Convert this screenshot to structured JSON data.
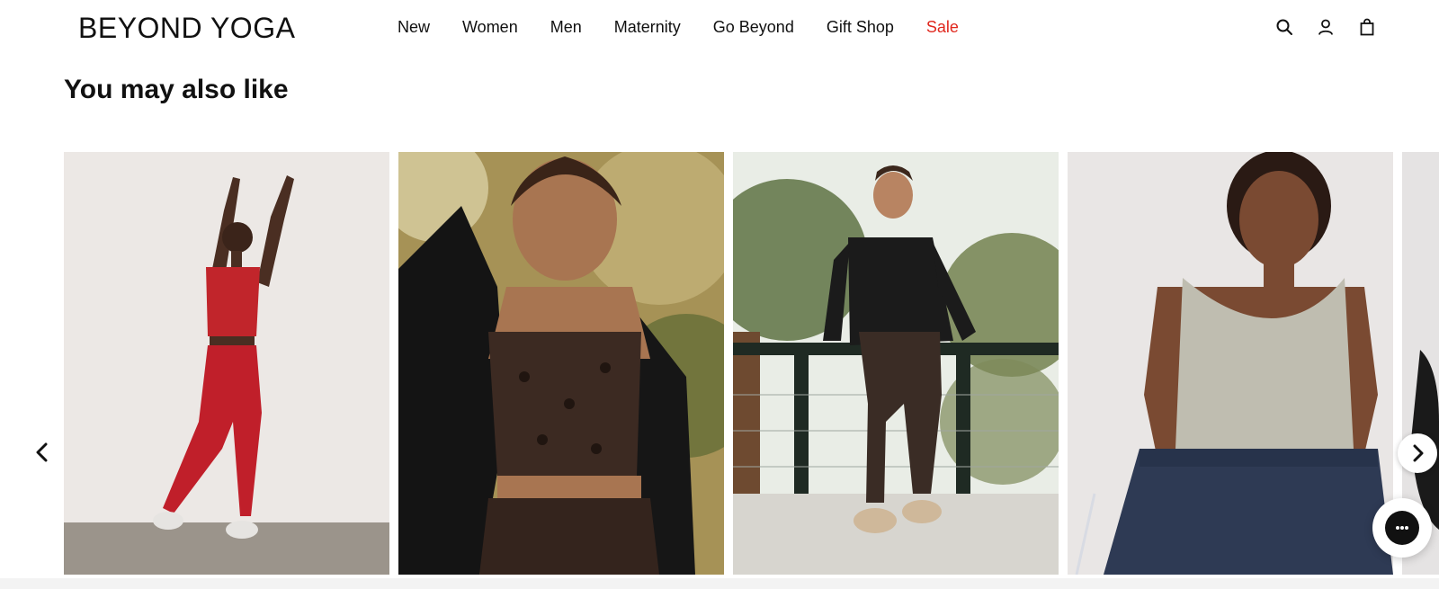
{
  "brand": {
    "logo_text": "BEYOND YOGA"
  },
  "nav": {
    "items": [
      {
        "label": "New"
      },
      {
        "label": "Women"
      },
      {
        "label": "Men"
      },
      {
        "label": "Maternity"
      },
      {
        "label": "Go Beyond"
      },
      {
        "label": "Gift Shop"
      },
      {
        "label": "Sale",
        "color": "#e0271d"
      }
    ]
  },
  "header_icons": [
    "search-icon",
    "account-icon",
    "shopping-bag-icon"
  ],
  "section": {
    "title": "You may also like"
  },
  "carousel": {
    "prev_icon": "chevron-left-icon",
    "next_icon": "chevron-right-icon",
    "products": [
      {
        "image": "woman in red crop top and red leggings stretching"
      },
      {
        "image": "woman in leopard print crop top with black jacket"
      },
      {
        "image": "woman in black half-zip pullover and leopard leggings on deck"
      },
      {
        "image": "woman in taupe tank top and navy sweatpants"
      },
      {
        "image": "partial product image"
      }
    ]
  },
  "chat": {
    "icon": "chat-bubble-icon"
  },
  "colors": {
    "accent_sale": "#e0271d",
    "text": "#111111"
  }
}
